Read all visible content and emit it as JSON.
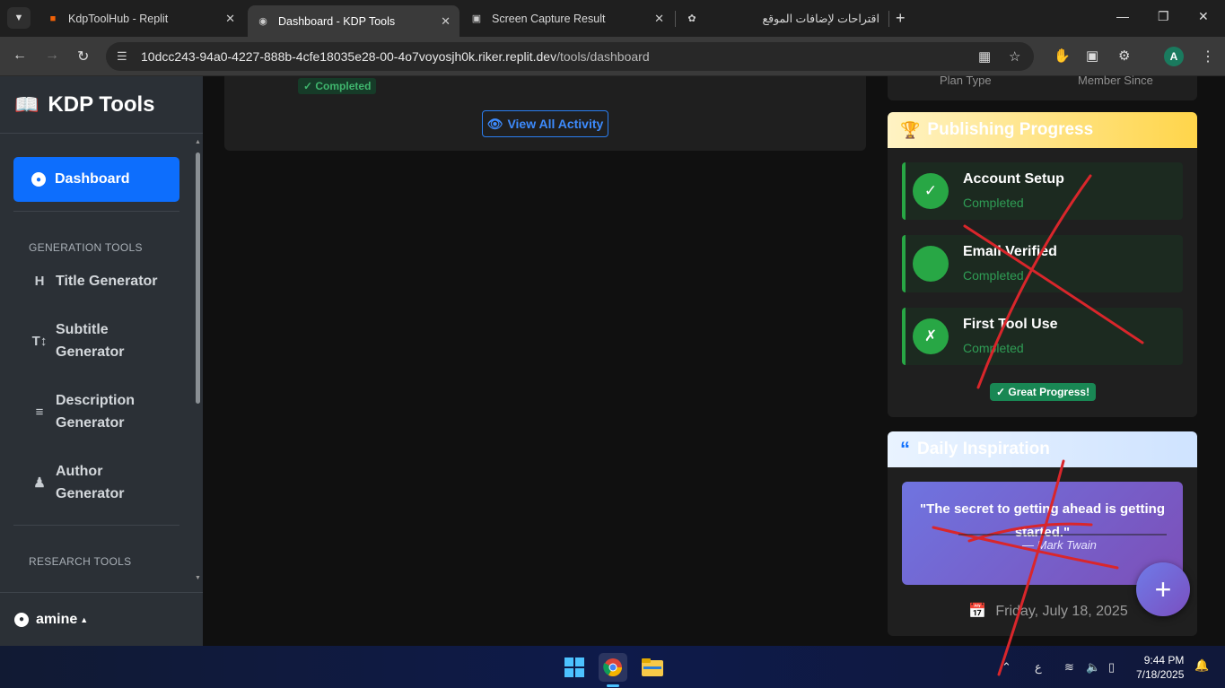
{
  "browser": {
    "tabs": [
      {
        "title": "KdpToolHub - Replit",
        "icon": "replit-icon"
      },
      {
        "title": "Dashboard - KDP Tools",
        "icon": "globe-icon",
        "active": true
      },
      {
        "title": "Screen Capture Result",
        "icon": "camera-icon"
      },
      {
        "title": "اقتراحات لإضافات الموقع",
        "icon": "chatgpt-icon"
      }
    ],
    "url_host": "10dcc243-94a0-4227-888b-4cfe18035e28-00-4o7voyosjh0k.riker.replit.dev",
    "url_path": "/tools/dashboard",
    "profile_initial": "A"
  },
  "sidebar": {
    "brand": "KDP Tools",
    "active_item": "Dashboard",
    "sections": [
      {
        "title": "GENERATION TOOLS"
      },
      {
        "title": "RESEARCH TOOLS"
      }
    ],
    "items": [
      {
        "label": "Title Generator"
      },
      {
        "label_line1": "Subtitle",
        "label_line2": "Generator"
      },
      {
        "label_line1": "Description",
        "label_line2": "Generator"
      },
      {
        "label_line1": "Author",
        "label_line2": "Generator"
      }
    ],
    "user": "amine"
  },
  "activity": {
    "badge": "Completed",
    "view_all": "View All Activity"
  },
  "account_info": {
    "plan_label": "Plan Type",
    "member_label": "Member Since"
  },
  "publishing": {
    "title": "Publishing Progress",
    "steps": [
      {
        "title": "Account Setup",
        "status": "Completed"
      },
      {
        "title": "Email Verified",
        "status": "Completed"
      },
      {
        "title": "First Tool Use",
        "status": "Completed"
      }
    ],
    "badge": "Great Progress!"
  },
  "inspiration": {
    "title": "Daily Inspiration",
    "quote": "\"The secret to getting ahead is getting started.\"",
    "author": "— Mark Twain",
    "date": "Friday, July 18, 2025"
  },
  "taskbar": {
    "time": "9:44 PM",
    "date": "7/18/2025",
    "lang": "ع"
  },
  "annotation_color": "#d9262b"
}
